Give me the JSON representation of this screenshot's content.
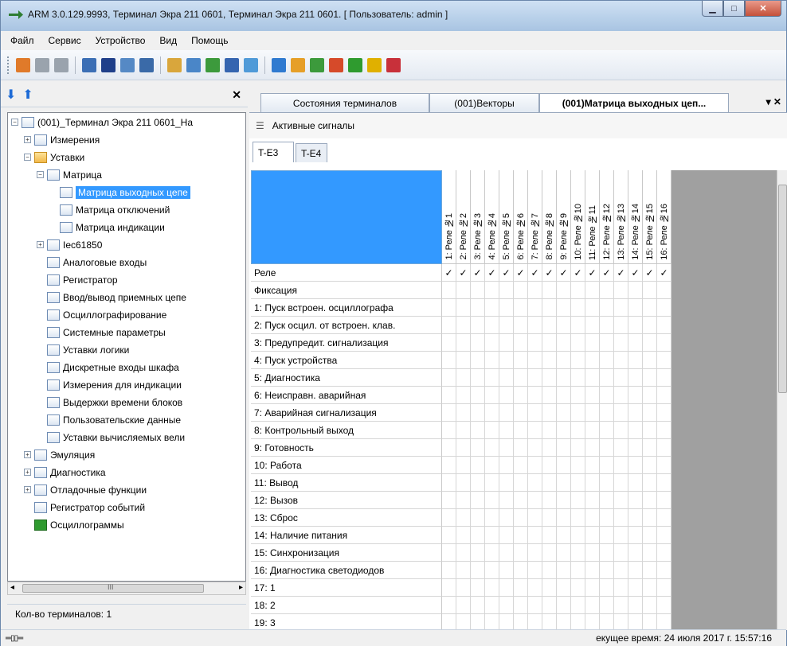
{
  "window": {
    "title": "ARM 3.0.129.9993, Терминал Экра 211 0601, Терминал Экра 211 0601. [ Пользователь: admin ]",
    "minimize_glyph": "▁",
    "maximize_glyph": "□",
    "close_glyph": "✕"
  },
  "menu": [
    "Файл",
    "Сервис",
    "Устройство",
    "Вид",
    "Помощь"
  ],
  "toolbar": {
    "icons": [
      {
        "name": "users-icon",
        "color": "#e07a2a"
      },
      {
        "name": "users-gray-icon",
        "color": "#9aa3ad"
      },
      {
        "name": "grid-icon",
        "color": "#9aa3ad"
      },
      {
        "sep": true
      },
      {
        "name": "list-icon",
        "color": "#3c6fb5"
      },
      {
        "name": "matrix-icon",
        "color": "#1f3f8a"
      },
      {
        "name": "table-icon",
        "color": "#5589c5"
      },
      {
        "name": "monitor-icon",
        "color": "#3a6aa8"
      },
      {
        "sep": true
      },
      {
        "name": "chart-icon",
        "color": "#d9a63c"
      },
      {
        "name": "report-icon",
        "color": "#4a86c8"
      },
      {
        "name": "network-icon",
        "color": "#3c9a3c"
      },
      {
        "name": "filter-icon",
        "color": "#3565b0"
      },
      {
        "name": "settings-icon",
        "color": "#4f9ad8"
      },
      {
        "sep": true
      },
      {
        "name": "device-icon",
        "color": "#2f7ad0"
      },
      {
        "name": "edit-icon",
        "color": "#e69f28"
      },
      {
        "name": "upload-icon",
        "color": "#3c9a3c"
      },
      {
        "name": "rss-icon",
        "color": "#d64a2a"
      },
      {
        "name": "refresh-icon",
        "color": "#2f9b2f"
      },
      {
        "name": "puzzle-icon",
        "color": "#e0b000"
      },
      {
        "name": "flag-icon",
        "color": "#c8303a"
      }
    ]
  },
  "left_panel": {
    "close_glyph": "✕",
    "down_arrow": "⬇",
    "up_arrow": "⬆",
    "tree": [
      {
        "label": "(001)_Терминал Экра 211 0601_На",
        "level": 0,
        "exp": "−",
        "icon": "computer-icon"
      },
      {
        "label": "Измерения",
        "level": 1,
        "exp": "+",
        "icon": "measure-icon"
      },
      {
        "label": "Уставки",
        "level": 1,
        "exp": "−",
        "icon": "folder-icon",
        "folder": true
      },
      {
        "label": "Матрица",
        "level": 2,
        "exp": "−",
        "icon": "matrix-icon"
      },
      {
        "label": "Матрица выходных цепе",
        "level": 3,
        "icon": "table-icon",
        "selected": true
      },
      {
        "label": "Матрица отключений",
        "level": 3,
        "icon": "table-icon"
      },
      {
        "label": "Матрица индикации",
        "level": 3,
        "icon": "table-icon"
      },
      {
        "label": "Iec61850",
        "level": 2,
        "exp": "+",
        "icon": "iec-icon"
      },
      {
        "label": "Аналоговые входы",
        "level": 2,
        "icon": "table-icon"
      },
      {
        "label": "Регистратор",
        "level": 2,
        "icon": "table-icon"
      },
      {
        "label": "Ввод/вывод приемных цепе",
        "level": 2,
        "icon": "table-icon"
      },
      {
        "label": "Осциллографирование",
        "level": 2,
        "icon": "table-icon"
      },
      {
        "label": "Системные параметры",
        "level": 2,
        "icon": "table-icon"
      },
      {
        "label": "Уставки логики",
        "level": 2,
        "icon": "table-icon"
      },
      {
        "label": "Дискретные входы шкафа",
        "level": 2,
        "icon": "table-icon"
      },
      {
        "label": "Измерения для индикации",
        "level": 2,
        "icon": "measure-icon"
      },
      {
        "label": "Выдержки времени блоков",
        "level": 2,
        "icon": "table-icon"
      },
      {
        "label": "Пользовательские данные",
        "level": 2,
        "icon": "table-icon"
      },
      {
        "label": "Уставки вычисляемых вели",
        "level": 2,
        "icon": "table-icon"
      },
      {
        "label": "Эмуляция",
        "level": 1,
        "exp": "+",
        "icon": "emulation-icon"
      },
      {
        "label": "Диагностика",
        "level": 1,
        "exp": "+",
        "icon": "diagnostics-icon"
      },
      {
        "label": "Отладочные функции",
        "level": 1,
        "exp": "+",
        "icon": "debug-icon"
      },
      {
        "label": "Регистратор событий",
        "level": 1,
        "icon": "events-icon"
      },
      {
        "label": "Осциллограммы",
        "level": 1,
        "icon": "oscillogram-icon",
        "green": true
      }
    ],
    "scroll_left": "◂",
    "scroll_mid": "III",
    "scroll_right": "▸",
    "status": "Кол-во терминалов: 1"
  },
  "tabs": [
    {
      "label": "Состояния терминалов",
      "active": false
    },
    {
      "label": "(001)Векторы",
      "active": false
    },
    {
      "label": "(001)Матрица выходных цеп...",
      "active": true
    }
  ],
  "tab_controls": "▾ ✕",
  "doc": {
    "toolbar_icon": "☰",
    "toolbar_label": "Активные сигналы",
    "subtabs": [
      {
        "label": "T-E3",
        "active": true
      },
      {
        "label": "T-E4",
        "active": false
      }
    ],
    "columns": [
      "1: Реле №1",
      "2: Реле №2",
      "3: Реле №3",
      "4: Реле №4",
      "5: Реле №5",
      "6: Реле №6",
      "7: Реле №7",
      "8: Реле №8",
      "9: Реле №9",
      "10: Реле №10",
      "11: Реле №11",
      "12: Реле №12",
      "13: Реле №13",
      "14: Реле №14",
      "15: Реле №15",
      "16: Реле №16"
    ],
    "check_glyph": "✓",
    "rows": [
      {
        "label": "Реле",
        "checks": true
      },
      {
        "label": "Фиксация",
        "checks": false
      },
      {
        "label": "1: Пуск встроен. осциллографа",
        "checks": false
      },
      {
        "label": "2: Пуск осцил. от встроен. клав.",
        "checks": false
      },
      {
        "label": "3: Предупредит. сигнализация",
        "checks": false
      },
      {
        "label": "4: Пуск устройства",
        "checks": false
      },
      {
        "label": "5: Диагностика",
        "checks": false
      },
      {
        "label": "6: Неисправн. аварийная",
        "checks": false
      },
      {
        "label": "7: Аварийная сигнализация",
        "checks": false
      },
      {
        "label": "8: Контрольный выход",
        "checks": false
      },
      {
        "label": "9: Готовность",
        "checks": false
      },
      {
        "label": "10: Работа",
        "checks": false
      },
      {
        "label": "11: Вывод",
        "checks": false
      },
      {
        "label": "12: Вызов",
        "checks": false
      },
      {
        "label": "13: Сброс",
        "checks": false
      },
      {
        "label": "14: Наличие питания",
        "checks": false
      },
      {
        "label": "15: Синхронизация",
        "checks": false
      },
      {
        "label": "16: Диагностика светодиодов",
        "checks": false
      },
      {
        "label": "17: 1",
        "checks": false
      },
      {
        "label": "18: 2",
        "checks": false
      },
      {
        "label": "19: 3",
        "checks": false
      }
    ]
  },
  "statusbar": {
    "left": "═▯▯═",
    "right": "екущее время: 24 июля 2017 г. 15:57:16"
  }
}
